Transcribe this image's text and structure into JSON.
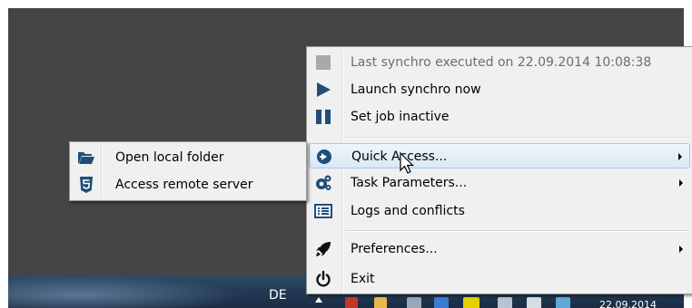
{
  "taskbar": {
    "language": "DE",
    "clock_date": "22.09.2014"
  },
  "context_menu": {
    "items": [
      {
        "label": "Last synchro executed on 22.09.2014 10:08:38",
        "icon": "status-square-icon",
        "disabled": true
      },
      {
        "label": "Launch synchro now",
        "icon": "play-icon"
      },
      {
        "label": "Set job inactive",
        "icon": "pause-icon"
      },
      {
        "label": "Quick Access...",
        "icon": "arrow-circle-right-icon",
        "submenu": true,
        "highlighted": true
      },
      {
        "label": "Task Parameters...",
        "icon": "gears-icon",
        "submenu": true
      },
      {
        "label": "Logs and conflicts",
        "icon": "list-icon"
      },
      {
        "label": "Preferences...",
        "icon": "rocket-icon",
        "submenu": true
      },
      {
        "label": "Exit",
        "icon": "power-icon"
      }
    ]
  },
  "quick_access_submenu": {
    "items": [
      {
        "label": "Open local folder",
        "icon": "folder-open-icon"
      },
      {
        "label": "Access remote server",
        "icon": "html5-icon"
      }
    ]
  },
  "colors": {
    "icon_blue": "#1f4e79",
    "highlight_border": "#a9c6e8",
    "desktop": "#444546"
  }
}
